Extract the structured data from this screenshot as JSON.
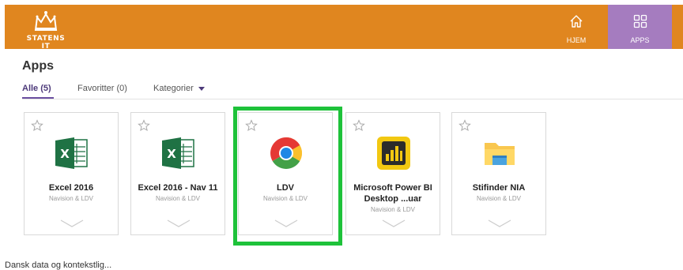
{
  "header": {
    "logo_text": "STATENS IT",
    "nav": [
      {
        "label": "HJEM",
        "icon": "home-icon"
      },
      {
        "label": "APPS",
        "icon": "apps-grid-icon"
      }
    ],
    "colors": {
      "bar": "#e0861f",
      "active_nav": "#a57cbf"
    }
  },
  "main": {
    "title": "Apps",
    "tabs": [
      {
        "label": "Alle (5)",
        "active": true
      },
      {
        "label": "Favoritter (0)",
        "active": false
      },
      {
        "label": "Kategorier",
        "active": false,
        "has_dropdown": true
      }
    ],
    "apps": [
      {
        "name": "Excel 2016",
        "sub": "Navision & LDV",
        "icon": "excel-icon"
      },
      {
        "name": "Excel 2016 - Nav 11",
        "sub": "Navision & LDV",
        "icon": "excel-icon"
      },
      {
        "name": "LDV",
        "sub": "Navision & LDV",
        "icon": "chrome-icon",
        "highlighted": true
      },
      {
        "name": "Microsoft Power BI Desktop ...uar",
        "sub": "Navision & LDV",
        "icon": "power-bi-icon"
      },
      {
        "name": "Stifinder NIA",
        "sub": "Navision & LDV",
        "icon": "folder-icon"
      }
    ],
    "highlight_color": "#1ec23a",
    "bottom_text": "Dansk data og kontekstlig..."
  }
}
